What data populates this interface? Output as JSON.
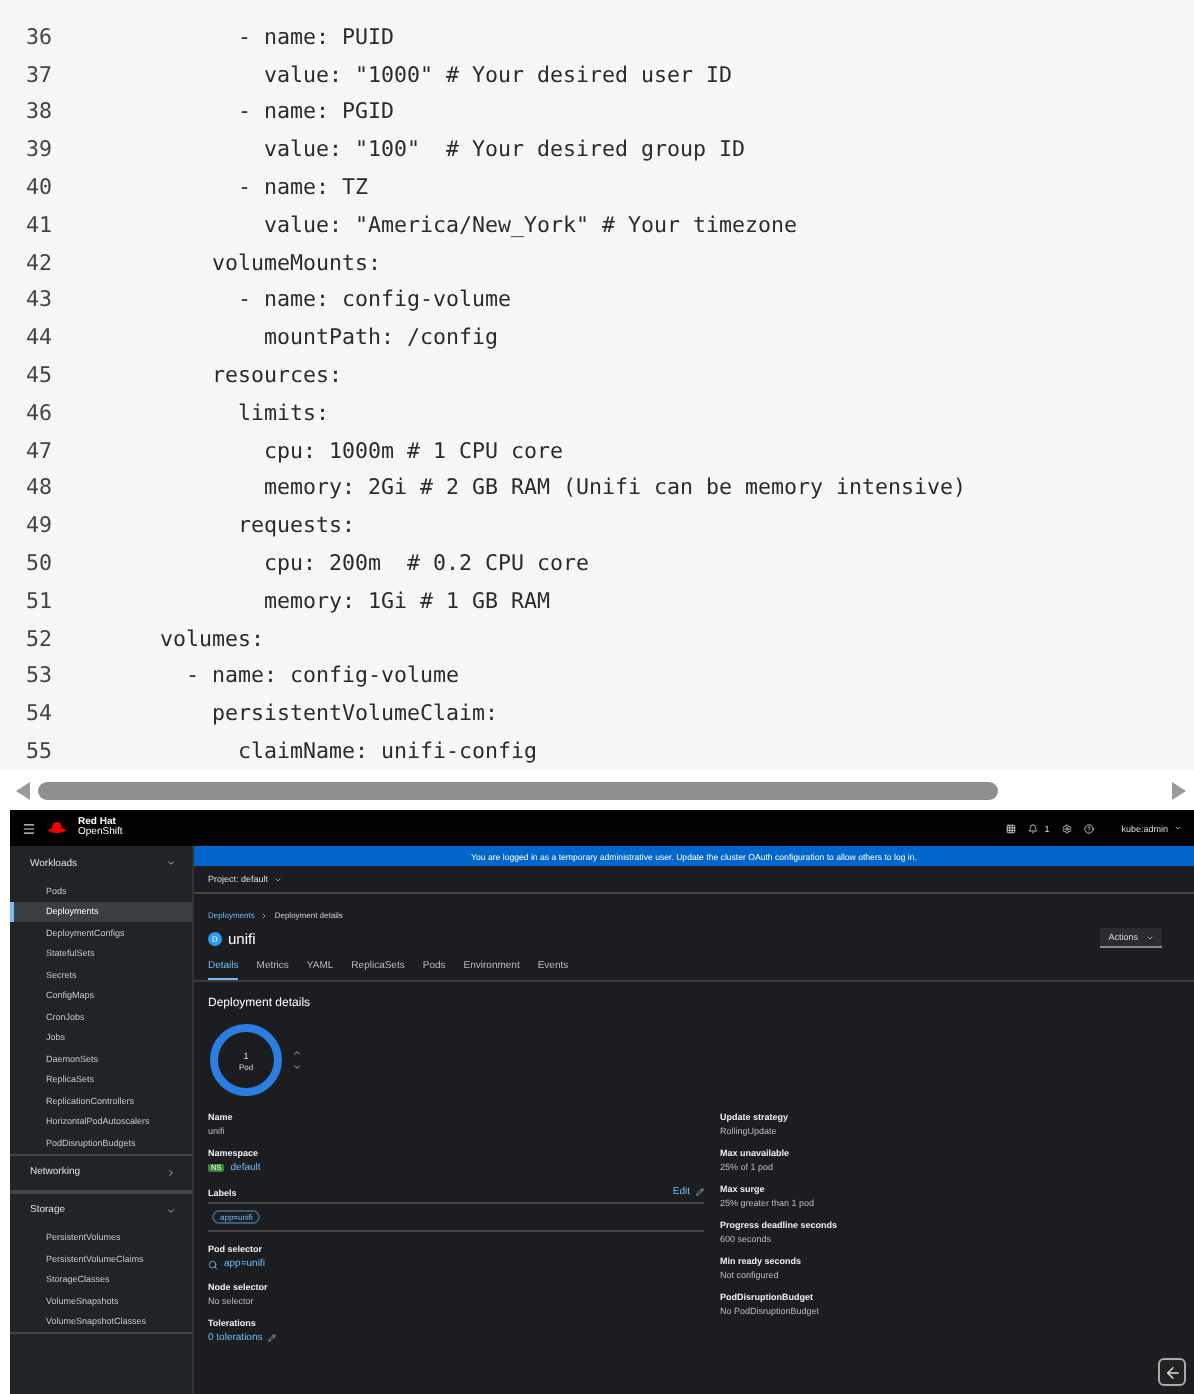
{
  "code": {
    "lines": [
      {
        "number": "36",
        "text": "          - name: PUID"
      },
      {
        "number": "37",
        "text": "            value: \"1000\" # Your desired user ID"
      },
      {
        "number": "38",
        "text": "          - name: PGID"
      },
      {
        "number": "39",
        "text": "            value: \"100\"  # Your desired group ID"
      },
      {
        "number": "40",
        "text": "          - name: TZ"
      },
      {
        "number": "41",
        "text": "            value: \"America/New_York\" # Your timezone"
      },
      {
        "number": "42",
        "text": "        volumeMounts:"
      },
      {
        "number": "43",
        "text": "          - name: config-volume"
      },
      {
        "number": "44",
        "text": "            mountPath: /config"
      },
      {
        "number": "45",
        "text": "        resources:"
      },
      {
        "number": "46",
        "text": "          limits:"
      },
      {
        "number": "47",
        "text": "            cpu: 1000m # 1 CPU core"
      },
      {
        "number": "48",
        "text": "            memory: 2Gi # 2 GB RAM (Unifi can be memory intensive)"
      },
      {
        "number": "49",
        "text": "          requests:"
      },
      {
        "number": "50",
        "text": "            cpu: 200m  # 0.2 CPU core"
      },
      {
        "number": "51",
        "text": "            memory: 1Gi # 1 GB RAM"
      },
      {
        "number": "52",
        "text": "    volumes:"
      },
      {
        "number": "53",
        "text": "      - name: config-volume"
      },
      {
        "number": "54",
        "text": "        persistentVolumeClaim:"
      },
      {
        "number": "55",
        "text": "          claimName: unifi-config"
      }
    ]
  },
  "console": {
    "header": {
      "brand_line1": "Red Hat",
      "brand_line2": "OpenShift",
      "notification_count": "1",
      "user": "kube:admin"
    },
    "banner": "You are logged in as a temporary administrative user. Update the cluster OAuth configuration to allow others to log in.",
    "sidebar": [
      {
        "label": "Workloads",
        "expanded": true,
        "items": [
          {
            "label": "Pods",
            "selected": false
          },
          {
            "label": "Deployments",
            "selected": true
          },
          {
            "label": "DeploymentConfigs",
            "selected": false
          },
          {
            "label": "StatefulSets",
            "selected": false
          },
          {
            "label": "Secrets",
            "selected": false
          },
          {
            "label": "ConfigMaps",
            "selected": false
          },
          {
            "label": "CronJobs",
            "selected": false
          },
          {
            "label": "Jobs",
            "selected": false
          },
          {
            "label": "DaemonSets",
            "selected": false
          },
          {
            "label": "ReplicaSets",
            "selected": false
          },
          {
            "label": "ReplicationControllers",
            "selected": false
          },
          {
            "label": "HorizontalPodAutoscalers",
            "selected": false
          },
          {
            "label": "PodDisruptionBudgets",
            "selected": false
          }
        ]
      },
      {
        "label": "Networking",
        "expanded": false
      },
      {
        "label": "Storage",
        "expanded": true,
        "items": [
          {
            "label": "PersistentVolumes",
            "selected": false
          },
          {
            "label": "PersistentVolumeClaims",
            "selected": false
          },
          {
            "label": "StorageClasses",
            "selected": false
          },
          {
            "label": "VolumeSnapshots",
            "selected": false
          },
          {
            "label": "VolumeSnapshotClasses",
            "selected": false
          }
        ]
      }
    ],
    "project": "Project: default",
    "breadcrumb": [
      "Deployments",
      "Deployment details"
    ],
    "kind_badge": "D",
    "title": "unifi",
    "actions": "Actions",
    "tabs": [
      {
        "label": "Details",
        "selected": true
      },
      {
        "label": "Metrics",
        "selected": false
      },
      {
        "label": "YAML",
        "selected": false
      },
      {
        "label": "ReplicaSets",
        "selected": false
      },
      {
        "label": "Pods",
        "selected": false
      },
      {
        "label": "Environment",
        "selected": false
      },
      {
        "label": "Events",
        "selected": false
      }
    ],
    "section_title": "Deployment details",
    "pod_ring": {
      "count": "1",
      "unit": "Pod"
    },
    "left_fields": [
      {
        "kind": "text",
        "label": "Name",
        "value": "unifi"
      },
      {
        "kind": "namespace",
        "label": "Namespace",
        "badge": "NS",
        "value": "default"
      },
      {
        "kind": "labels",
        "label": "Labels",
        "action": "Edit",
        "value": "app=unifi"
      },
      {
        "kind": "selector",
        "label": "Pod selector",
        "value": "app=unifi"
      },
      {
        "kind": "text",
        "label": "Node selector",
        "value": "No selector"
      },
      {
        "kind": "editlink",
        "label": "Tolerations",
        "value": "0 tolerations"
      }
    ],
    "right_fields": [
      {
        "kind": "text",
        "label": "Update strategy",
        "value": "RollingUpdate"
      },
      {
        "kind": "text",
        "label": "Max unavailable",
        "value": "25% of 1 pod"
      },
      {
        "kind": "text",
        "label": "Max surge",
        "value": "25% greater than 1 pod"
      },
      {
        "kind": "text",
        "label": "Progress deadline seconds",
        "value": "600 seconds"
      },
      {
        "kind": "text",
        "label": "Min ready seconds",
        "value": "Not configured"
      },
      {
        "kind": "text",
        "label": "PodDisruptionBudget",
        "value": "No PodDisruptionBudget"
      }
    ]
  }
}
